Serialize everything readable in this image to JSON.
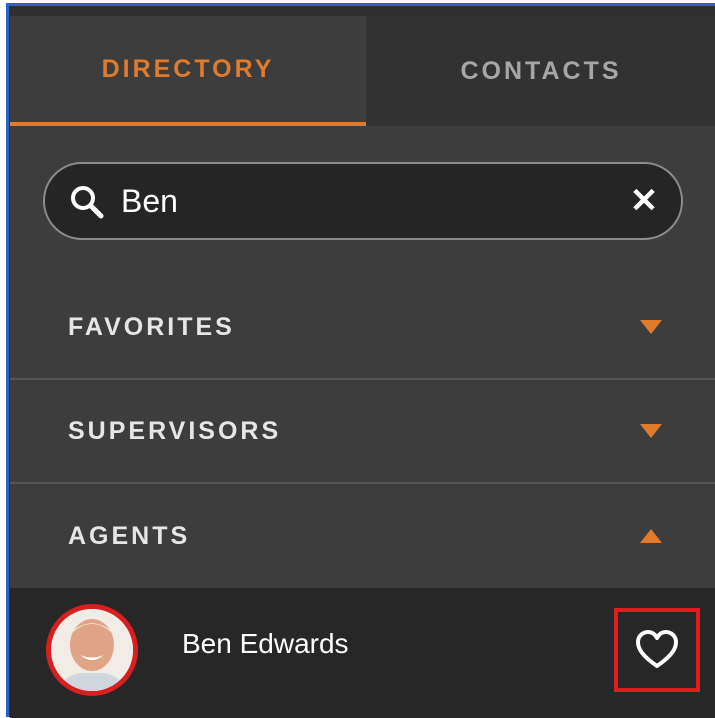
{
  "tabs": [
    {
      "label": "DIRECTORY",
      "active": true
    },
    {
      "label": "CONTACTS",
      "active": false
    }
  ],
  "search": {
    "value": "Ben",
    "icon": "search-icon",
    "clear_icon": "close-icon"
  },
  "sections": [
    {
      "label": "FAVORITES",
      "expanded": false
    },
    {
      "label": "SUPERVISORS",
      "expanded": false
    },
    {
      "label": "AGENTS",
      "expanded": true
    }
  ],
  "agents": [
    {
      "name": "Ben Edwards",
      "favorite_icon": "heart-outline-icon",
      "avatar": "avatar-photo"
    }
  ],
  "colors": {
    "accent": "#e07a2c",
    "panel": "#3d3d3d",
    "highlight_red": "#e01c1c"
  }
}
